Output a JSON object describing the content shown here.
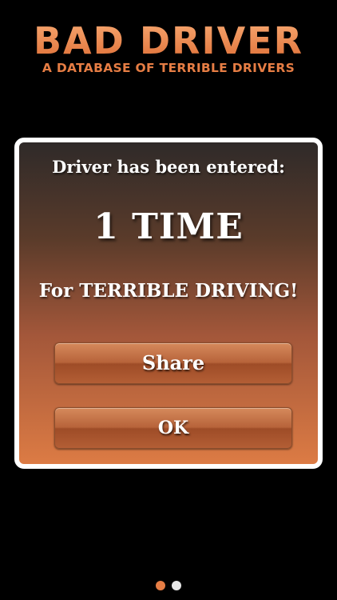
{
  "logo": {
    "title": "BAD DRIVER",
    "subtitle": "A DATABASE OF TERRIBLE DRIVERS"
  },
  "dialog": {
    "title": "Driver has been entered:",
    "count": "1 TIME",
    "message": "For TERRIBLE DRIVING!",
    "share_label": "Share",
    "ok_label": "OK"
  },
  "pager": {
    "pages": 2,
    "active_page": 1
  },
  "colors": {
    "brand_orange": "#e67d44",
    "background": "#000000",
    "dialog_border": "#ffffff"
  }
}
